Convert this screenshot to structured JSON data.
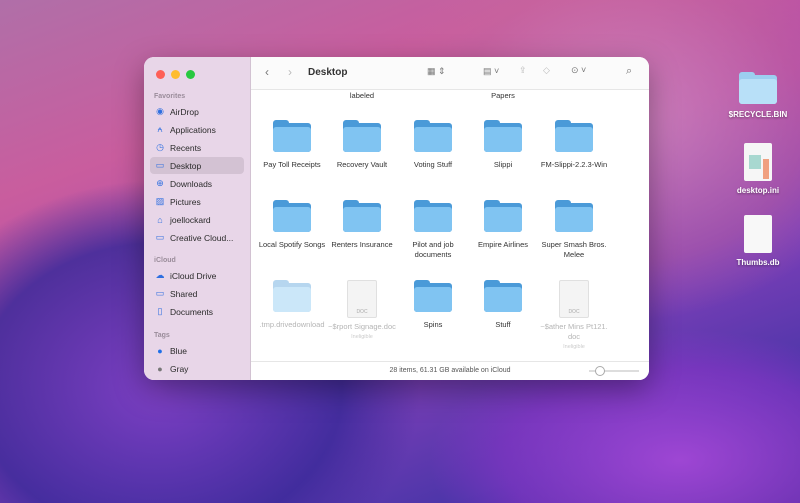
{
  "window": {
    "title": "Desktop",
    "status": "28 items, 61.31 GB available on iCloud"
  },
  "sidebar": {
    "favorites_label": "Favorites",
    "favorites": [
      {
        "label": "AirDrop",
        "icon": "airdrop-icon"
      },
      {
        "label": "Applications",
        "icon": "applications-icon"
      },
      {
        "label": "Recents",
        "icon": "clock-icon"
      },
      {
        "label": "Desktop",
        "icon": "desktop-icon",
        "selected": true
      },
      {
        "label": "Downloads",
        "icon": "download-icon"
      },
      {
        "label": "Pictures",
        "icon": "pictures-icon"
      },
      {
        "label": "joellockard",
        "icon": "home-icon"
      },
      {
        "label": "Creative Cloud...",
        "icon": "folder-icon"
      }
    ],
    "icloud_label": "iCloud",
    "icloud": [
      {
        "label": "iCloud Drive"
      },
      {
        "label": "Shared"
      },
      {
        "label": "Documents"
      }
    ],
    "tags_label": "Tags",
    "tags": [
      {
        "label": "Blue",
        "color": "#1f6fe8"
      },
      {
        "label": "Gray",
        "color": "#777777"
      }
    ]
  },
  "files": {
    "partial": [
      "labeled",
      "Papers"
    ],
    "row1": [
      "Pay Toll Receipts",
      "Recovery Vault",
      "Voting Stuff",
      "Slippi",
      "FM-Slippi-2.2.3-Win"
    ],
    "row2": [
      "Local Spotify Songs",
      "Renters Insurance",
      "Pilot and job documents",
      "Empire Airlines",
      "Super Smash Bros. Melee"
    ],
    "row3": [
      {
        "name": ".tmp.drivedownload",
        "kind": "folder-faded"
      },
      {
        "name": "~$rport Signage.doc",
        "kind": "doc",
        "badge": "DOC",
        "note": "Ineligible"
      },
      {
        "name": "Spins",
        "kind": "folder"
      },
      {
        "name": "Stuff",
        "kind": "folder"
      },
      {
        "name": "~$ather Mins Pt121.doc",
        "kind": "doc",
        "badge": "DOC",
        "note": "Ineligible"
      }
    ]
  },
  "desktop": [
    "$RECYCLE.BIN",
    "desktop.ini",
    "Thumbs.db"
  ]
}
